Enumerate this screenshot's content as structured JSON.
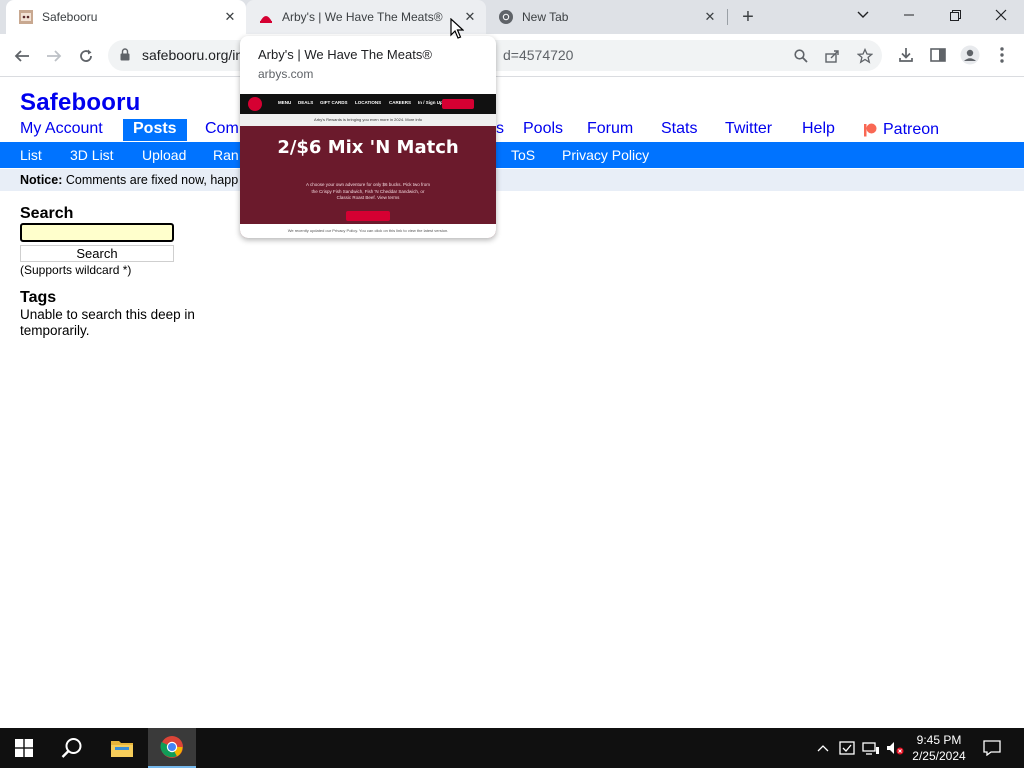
{
  "browser": {
    "tabs": [
      {
        "title": "Safebooru",
        "state": "active",
        "icon": "safebooru-favicon"
      },
      {
        "title": "Arby's | We Have The Meats®",
        "state": "hover",
        "icon": "arbys-favicon"
      },
      {
        "title": "New Tab",
        "state": "inactive",
        "icon": "chrome-favicon"
      }
    ],
    "url_visible": "safebooru.org/in",
    "url_tail": "d=4574720"
  },
  "hover_card": {
    "title": "Arby's | We Have The Meats®",
    "domain": "arbys.com",
    "preview": {
      "nav_items": [
        "MENU",
        "DEALS",
        "GIFT CARDS",
        "LOCATIONS",
        "CAREERS",
        "In / Sign Up"
      ],
      "order_button": "ORDER AN ORDER",
      "banner": "Arby's Rewards is bringing you even more in 2024. More info",
      "headline": "2/$6 Mix 'N Match",
      "body": "A choose your own adventure for only $6 bucks. Pick two from the Crispy Fish Sandwich, Fish 'N Cheddar Sandwich, or Classic Roast Beef. View terms",
      "cta": "ORDER NOW",
      "footer": "We recently updated our Privacy Policy. You can click on this link to view the latest version."
    }
  },
  "site": {
    "title": "Safebooru",
    "main_nav": [
      "My Account",
      "Posts",
      "Com",
      "s",
      "Pools",
      "Forum",
      "Stats",
      "Twitter",
      "Help",
      "Patreon"
    ],
    "active_main": "Posts",
    "sub_nav": [
      "List",
      "3D List",
      "Upload",
      "Ran",
      "ToS",
      "Privacy Policy"
    ],
    "notice_label": "Notice:",
    "notice_text": " Comments are fixed now, happ",
    "search_heading": "Search",
    "search_value": "",
    "search_button": "Search",
    "wildcard_note": "(Supports wildcard *)",
    "tags_heading": "Tags",
    "tags_text": "Unable to search this deep in temporarily."
  },
  "taskbar": {
    "time": "9:45 PM",
    "date": "2/25/2024",
    "pinned": [
      "start-icon",
      "search-icon",
      "file-explorer-icon",
      "chrome-icon"
    ]
  },
  "colors": {
    "link_blue": "#0000ee",
    "nav_blue": "#0073ff",
    "notice_bg": "#e8eef7",
    "search_bg": "#ffffcc",
    "arbys_red": "#d50032",
    "arbys_maroon": "#6b1a2c"
  }
}
